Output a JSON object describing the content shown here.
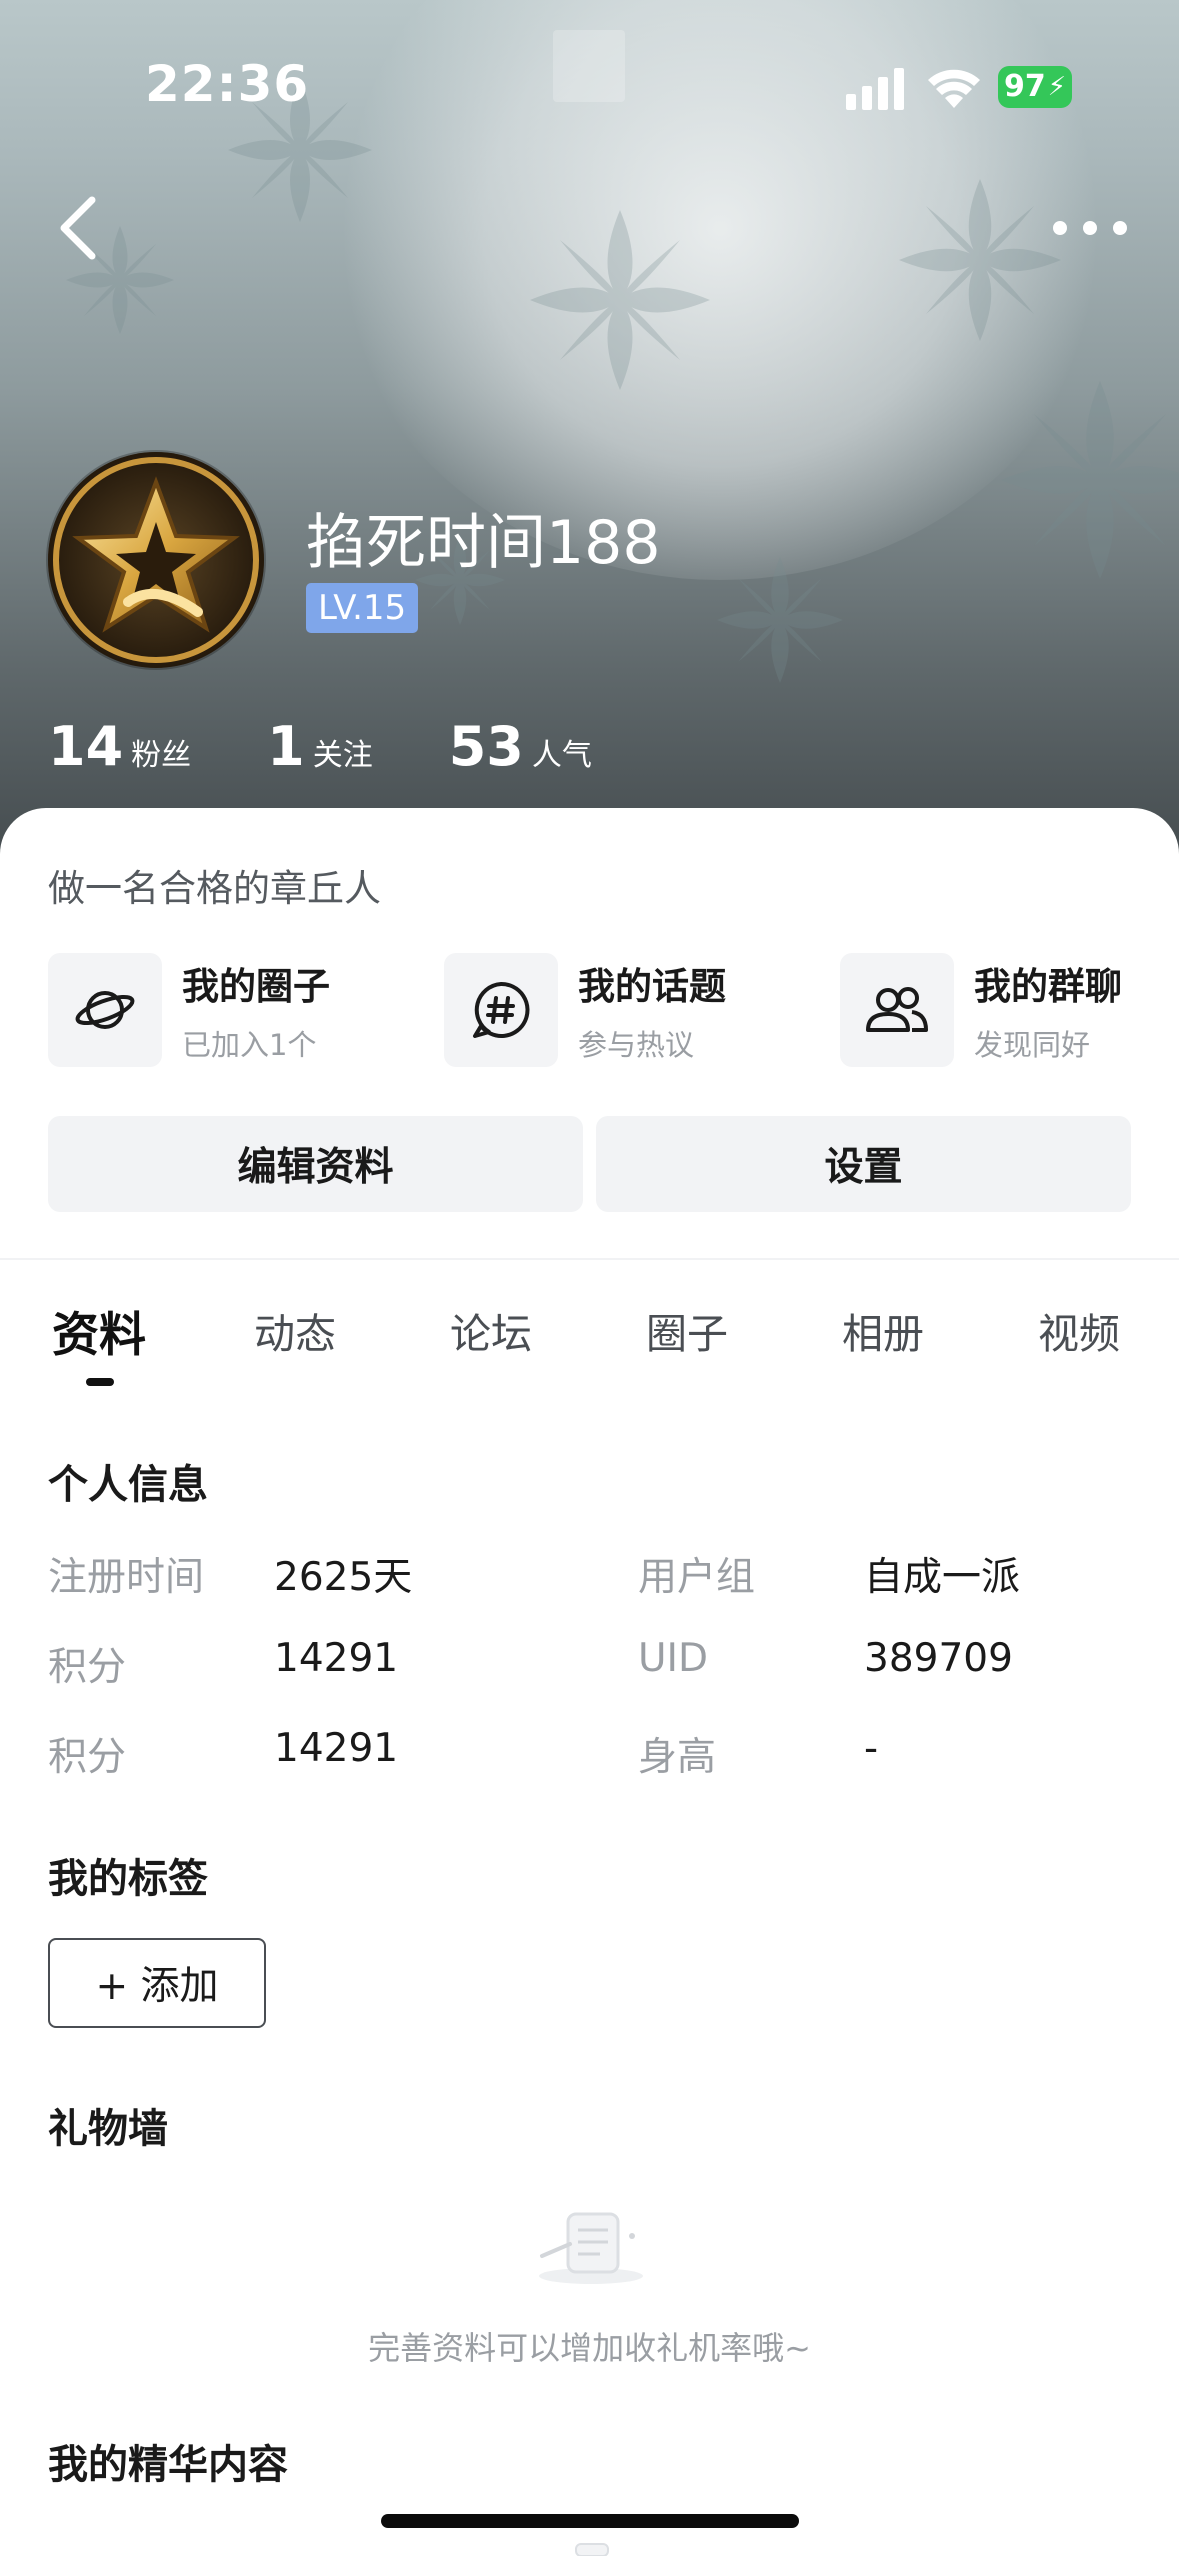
{
  "status_bar": {
    "time": "22:36",
    "battery": "97"
  },
  "nav": {
    "back_icon": "chevron-left-icon",
    "more_icon": "more-dots-icon"
  },
  "profile": {
    "username": "掐死时间188",
    "level": "LV.15",
    "stats": [
      {
        "num": "14",
        "label": "粉丝"
      },
      {
        "num": "1",
        "label": "关注"
      },
      {
        "num": "53",
        "label": "人气"
      }
    ],
    "signature": "做一名合格的章丘人"
  },
  "features": [
    {
      "title": "我的圈子",
      "sub": "已加入1个",
      "icon": "planet-icon"
    },
    {
      "title": "我的话题",
      "sub": "参与热议",
      "icon": "hashtag-chat-icon"
    },
    {
      "title": "我的群聊",
      "sub": "发现同好",
      "icon": "group-users-icon"
    }
  ],
  "actions": {
    "edit": "编辑资料",
    "settings": "设置"
  },
  "tabs": [
    "资料",
    "动态",
    "论坛",
    "圈子",
    "相册",
    "视频"
  ],
  "active_tab": "资料",
  "personal_info": {
    "title": "个人信息",
    "rows": [
      {
        "l1": "注册时间",
        "v1": "2625天",
        "l2": "用户组",
        "v2": "自成一派"
      },
      {
        "l1": "积分",
        "v1": "14291",
        "l2": "UID",
        "v2": "389709"
      },
      {
        "l1": "积分",
        "v1": "14291",
        "l2": "身高",
        "v2": "-"
      }
    ]
  },
  "tags": {
    "title": "我的标签",
    "add_label": "+ 添加"
  },
  "gift_wall": {
    "title": "礼物墙",
    "empty_text": "完善资料可以增加收礼机率哦~"
  },
  "featured": {
    "title": "我的精华内容"
  },
  "colors": {
    "accent_badge": "#7fa6ea",
    "battery": "#34c759"
  }
}
